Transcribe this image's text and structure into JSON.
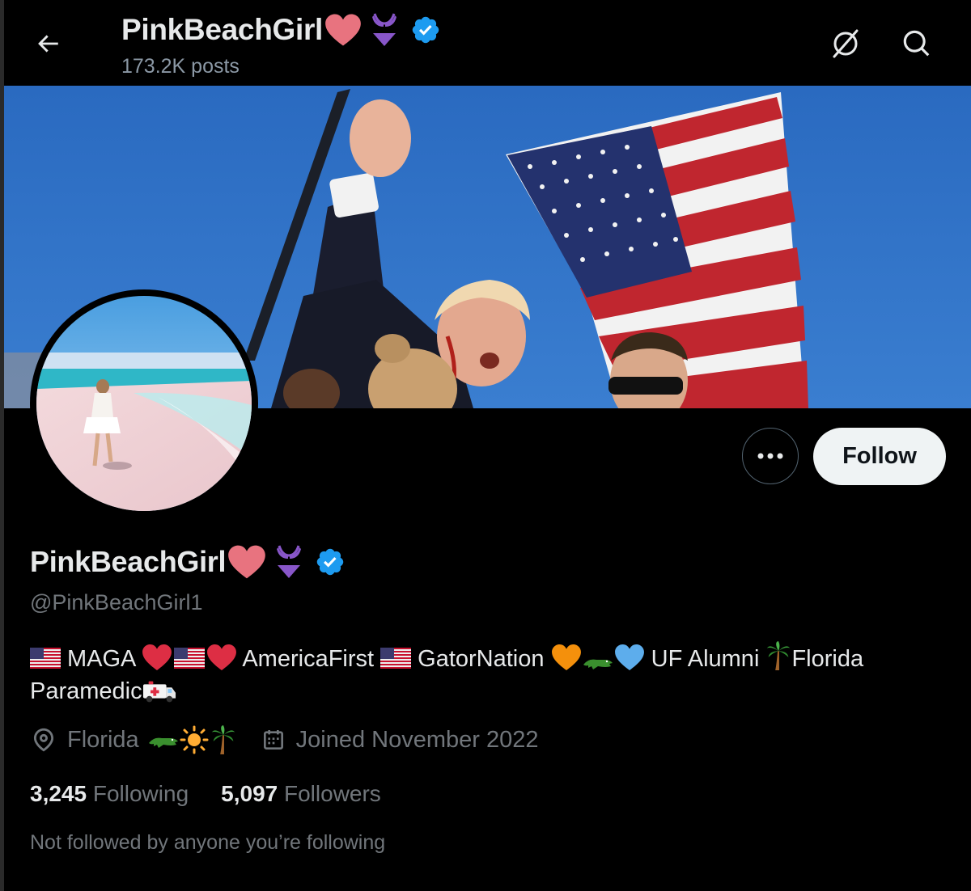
{
  "header": {
    "title": "PinkBeachGirl",
    "posts_count": "173.2K posts",
    "icons": [
      "back-arrow-icon",
      "grok-icon",
      "search-icon"
    ]
  },
  "banner": {
    "description_icon": "banner-photo"
  },
  "profile": {
    "display_name": "PinkBeachGirl",
    "handle": "@PinkBeachGirl1",
    "verified_color": "#1d9bf0",
    "bio": {
      "part1": "MAGA",
      "part2": "AmericaFirst",
      "part3": "GatorNation",
      "part4": "UF Alumni",
      "part5": "Florida",
      "part6": "Paramedic"
    },
    "location": "Florida",
    "joined": "Joined November 2022",
    "following_count": "3,245",
    "following_label": "Following",
    "followers_count": "5,097",
    "followers_label": "Followers",
    "not_followed_text": "Not followed by anyone you’re following"
  },
  "actions": {
    "follow_label": "Follow",
    "more_icon": "more-dots-icon"
  },
  "colors": {
    "background": "#000000",
    "text_primary": "#e7e9ea",
    "text_secondary": "#71767b",
    "follow_bg": "#eff3f4",
    "heart_pink": "#e8737f",
    "bikini_purple": "#8856c9"
  }
}
